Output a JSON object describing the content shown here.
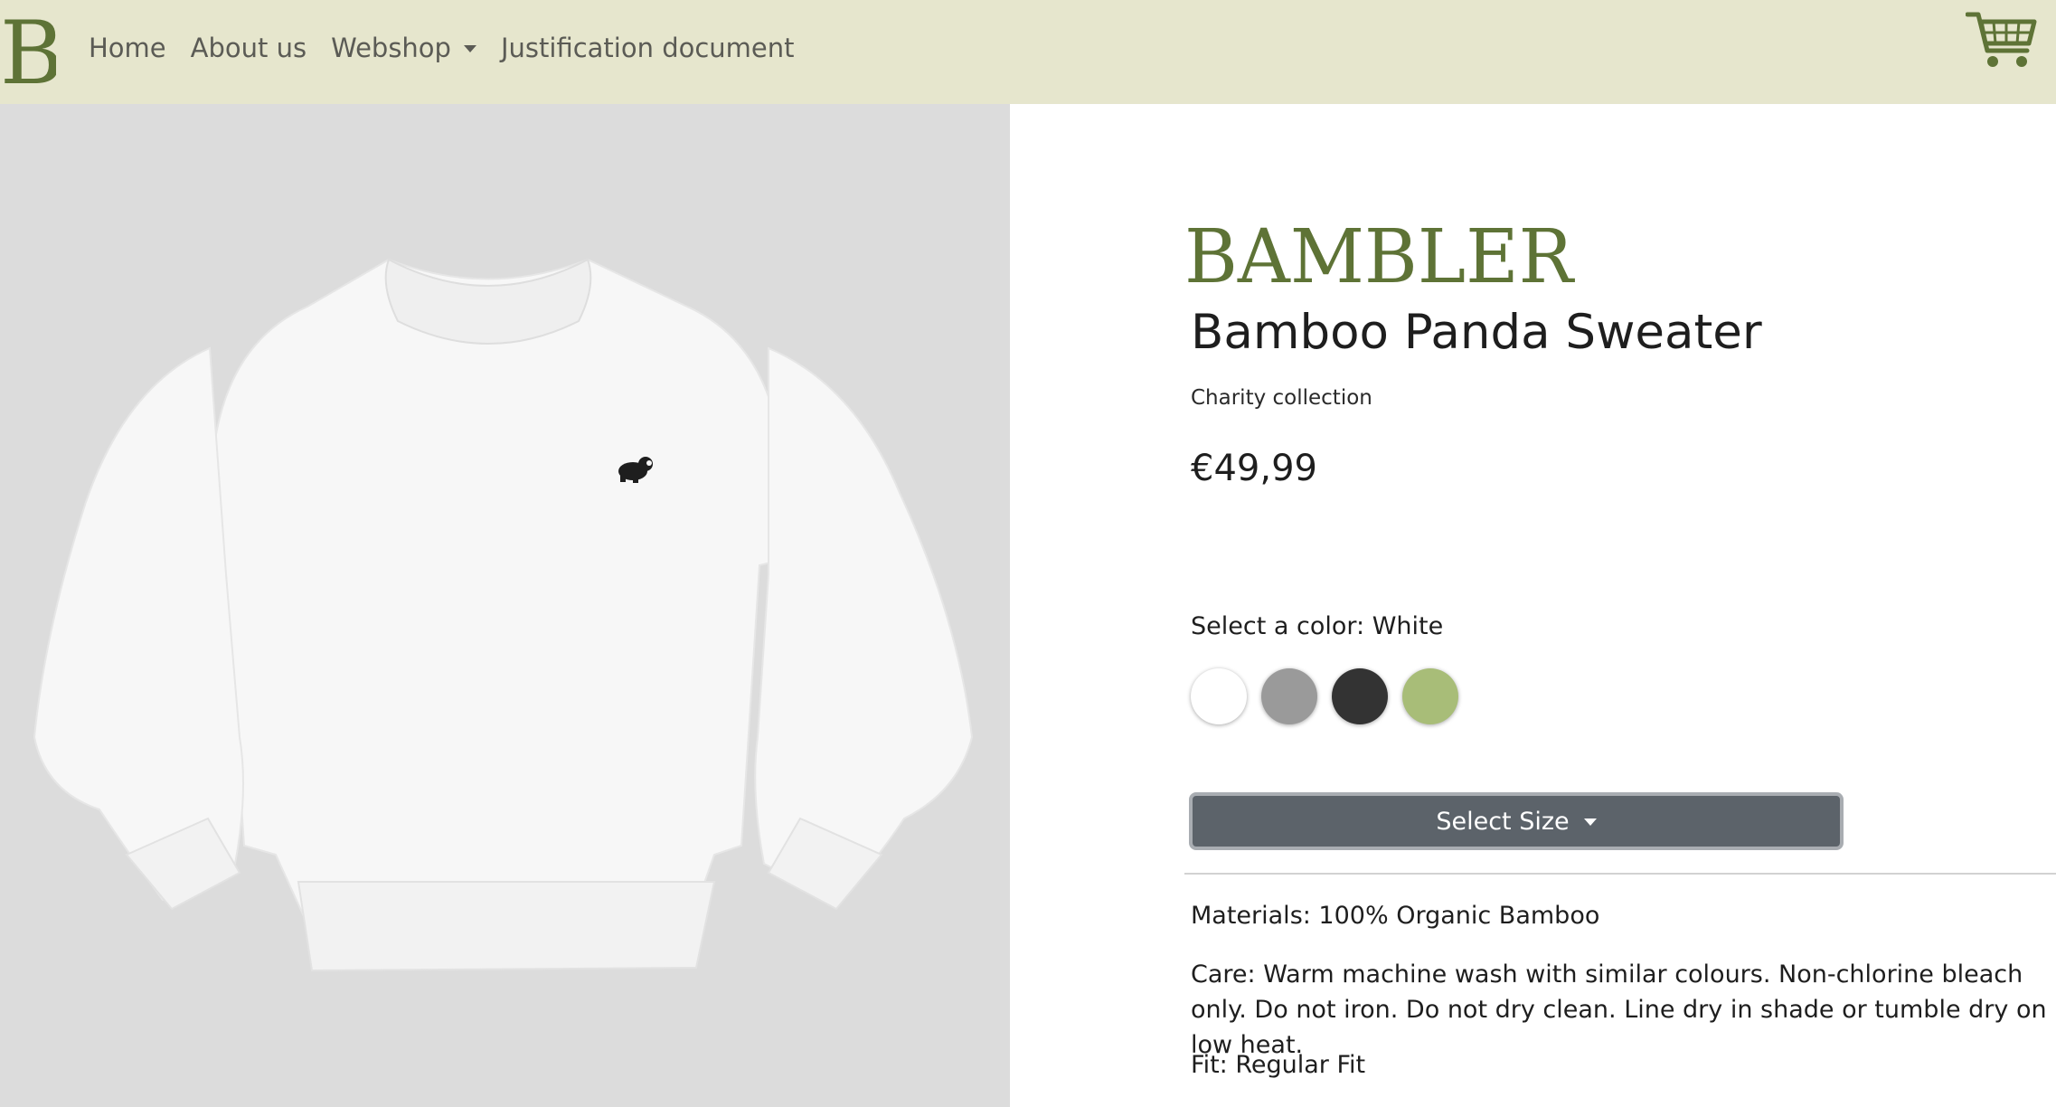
{
  "nav": {
    "brand_letter": "B",
    "links": [
      {
        "label": "Home"
      },
      {
        "label": "About us"
      },
      {
        "label": "Webshop"
      },
      {
        "label": "Justification document"
      }
    ]
  },
  "product": {
    "brand_wordmark": "BAMBLER",
    "title": "Bamboo Panda Sweater",
    "collection": "Charity collection",
    "price": "€49,99",
    "color_label": "Select a color: White",
    "swatches": [
      {
        "color": "#ffffff"
      },
      {
        "color": "#9a9a9a"
      },
      {
        "color": "#333333"
      },
      {
        "color": "#a8bd78"
      }
    ],
    "size_button_label": "Select Size",
    "materials": "Materials: 100% Organic Bamboo",
    "care": "Care: Warm machine wash with similar colours. Non-chlorine bleach only. Do not iron. Do not dry clean. Line dry in shade or tumble dry on low heat.",
    "fit": "Fit: Regular Fit"
  },
  "colors": {
    "navbar_bg": "#e6e6cd",
    "brand_green": "#5e7336",
    "image_bg": "#dcdcdc",
    "button_bg": "#5c636a"
  }
}
